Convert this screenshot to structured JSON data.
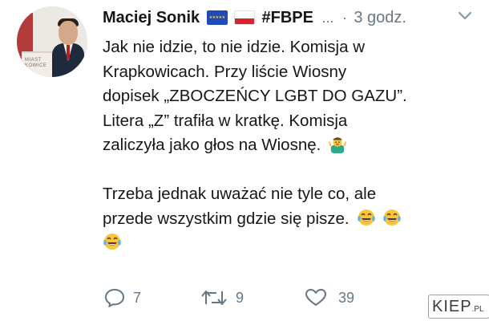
{
  "tweet": {
    "author_name": "Maciej Sonik",
    "flag_icons": [
      "eu-flag-icon",
      "poland-flag-icon"
    ],
    "hashtag": "#FBPE",
    "ellipsis": "...",
    "separator": "·",
    "time": "3 godz.",
    "body_lines": [
      "Jak nie idzie, to nie idzie. Komisja w",
      "Krapkowicach. Przy liście Wiosny",
      "dopisek „ZBOCZEŃCY LGBT DO GAZU”.",
      "Litera „Z” trafiła w kratkę. Komisja",
      "zaliczyła jako głos na Wiosnę.",
      "",
      "Trzeba jednak uważać nie tyle co, ale",
      "przede wszystkim gdzie się pisze."
    ],
    "inline_emojis": [
      "person-shrugging-emoji",
      "tears-of-joy-emoji",
      "tears-of-joy-emoji",
      "tears-of-joy-emoji"
    ],
    "actions": {
      "reply_count": "7",
      "retweet_count": "9",
      "like_count": "39"
    }
  },
  "watermark": {
    "main": "KIEP",
    "tld": ".PL"
  },
  "colors": {
    "text": "#14171a",
    "muted": "#657786",
    "eu_blue": "#1f4bb8",
    "poland_red": "#d9242e",
    "emoji_yellow": "#f8c63a"
  }
}
